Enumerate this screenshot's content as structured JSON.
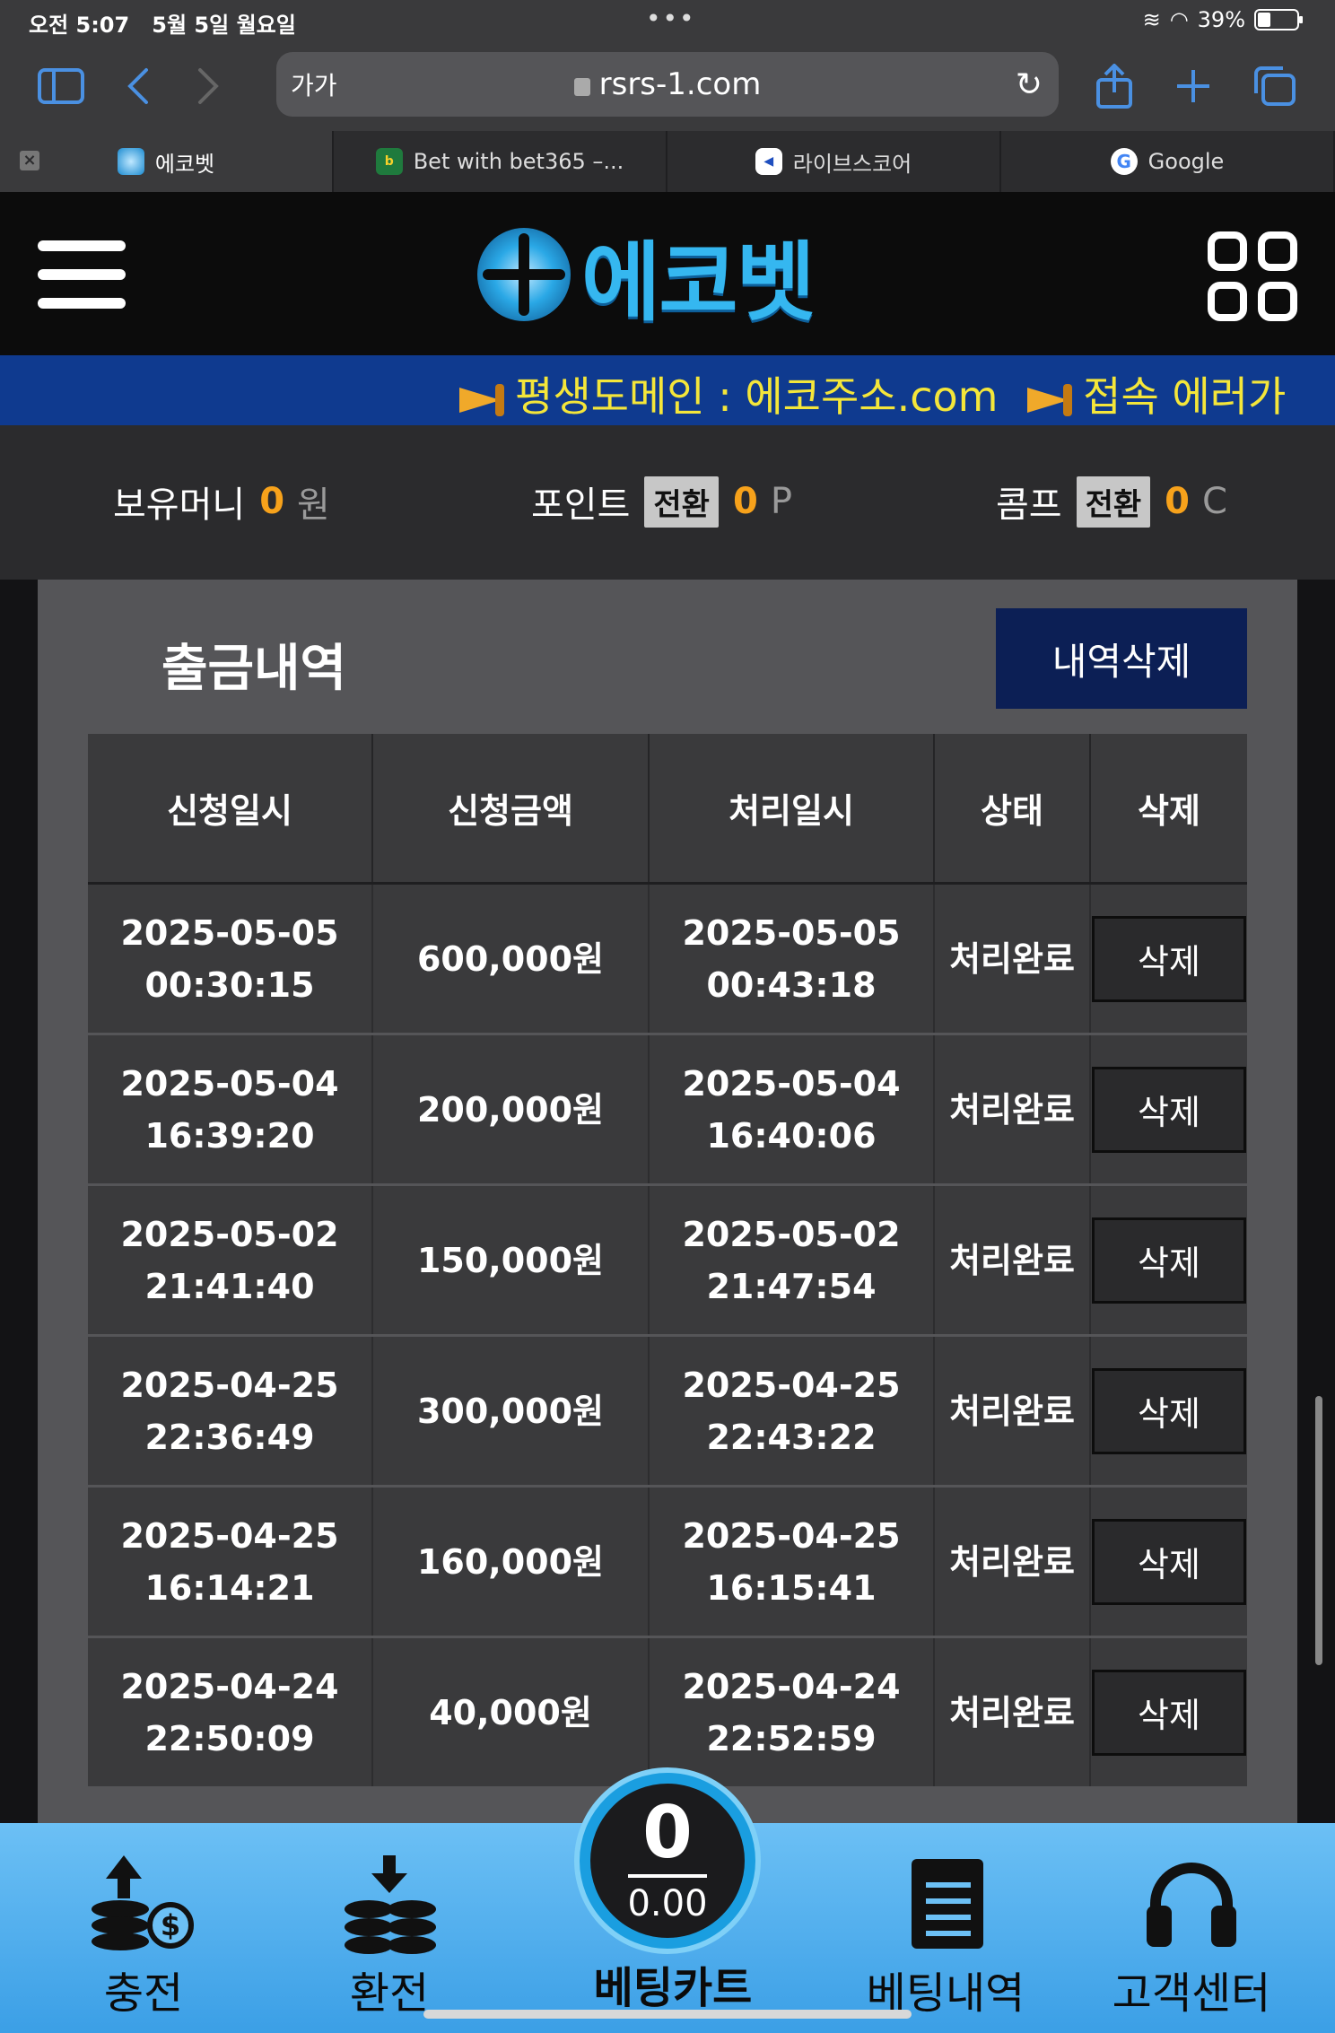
{
  "status_bar": {
    "time": "오전 5:07",
    "date": "5월 5일 월요일",
    "battery": "39%"
  },
  "browser": {
    "aa_label": "가가",
    "url": "rsrs-1.com",
    "tabs": [
      {
        "title": "에코벳",
        "active": true
      },
      {
        "title": "Bet with bet365 –...",
        "active": false
      },
      {
        "title": "라이브스코어",
        "active": false
      },
      {
        "title": "Google",
        "active": false
      }
    ]
  },
  "site": {
    "logo_text": "에코벳",
    "marquee": [
      "평생도메인 : 에코주소.com",
      "접속 에러가"
    ],
    "wallet": {
      "money_label": "보유머니",
      "money_value": "0",
      "money_unit": "원",
      "point_label": "포인트",
      "point_button": "전환",
      "point_value": "0",
      "point_unit": "P",
      "comp_label": "콤프",
      "comp_button": "전환",
      "comp_value": "0",
      "comp_unit": "C"
    }
  },
  "withdrawal": {
    "title": "출금내역",
    "delete_all_label": "내역삭제",
    "headers": [
      "신청일시",
      "신청금액",
      "처리일시",
      "상태",
      "삭제"
    ],
    "rows": [
      {
        "req_date": "2025-05-05",
        "req_time": "00:30:15",
        "amount": "600,000원",
        "proc_date": "2025-05-05",
        "proc_time": "00:43:18",
        "status": "처리완료",
        "delete": "삭제"
      },
      {
        "req_date": "2025-05-04",
        "req_time": "16:39:20",
        "amount": "200,000원",
        "proc_date": "2025-05-04",
        "proc_time": "16:40:06",
        "status": "처리완료",
        "delete": "삭제"
      },
      {
        "req_date": "2025-05-02",
        "req_time": "21:41:40",
        "amount": "150,000원",
        "proc_date": "2025-05-02",
        "proc_time": "21:47:54",
        "status": "처리완료",
        "delete": "삭제"
      },
      {
        "req_date": "2025-04-25",
        "req_time": "22:36:49",
        "amount": "300,000원",
        "proc_date": "2025-04-25",
        "proc_time": "22:43:22",
        "status": "처리완료",
        "delete": "삭제"
      },
      {
        "req_date": "2025-04-25",
        "req_time": "16:14:21",
        "amount": "160,000원",
        "proc_date": "2025-04-25",
        "proc_time": "16:15:41",
        "status": "처리완료",
        "delete": "삭제"
      },
      {
        "req_date": "2025-04-24",
        "req_time": "22:50:09",
        "amount": "40,000원",
        "proc_date": "2025-04-24",
        "proc_time": "22:52:59",
        "status": "처리완료",
        "delete": "삭제"
      }
    ]
  },
  "bottom_nav": {
    "deposit": "충전",
    "withdraw": "환전",
    "cart_label": "베팅카트",
    "cart_count": "0",
    "cart_amount": "0.00",
    "bet_history": "베팅내역",
    "support": "고객센터"
  },
  "colors": {
    "accent_orange": "#f7a21b",
    "marquee_bg": "#0f3a8f",
    "marquee_text": "#f4e63a",
    "nav_blue": "#3b9fe6",
    "button_navy": "#0c1f55"
  }
}
